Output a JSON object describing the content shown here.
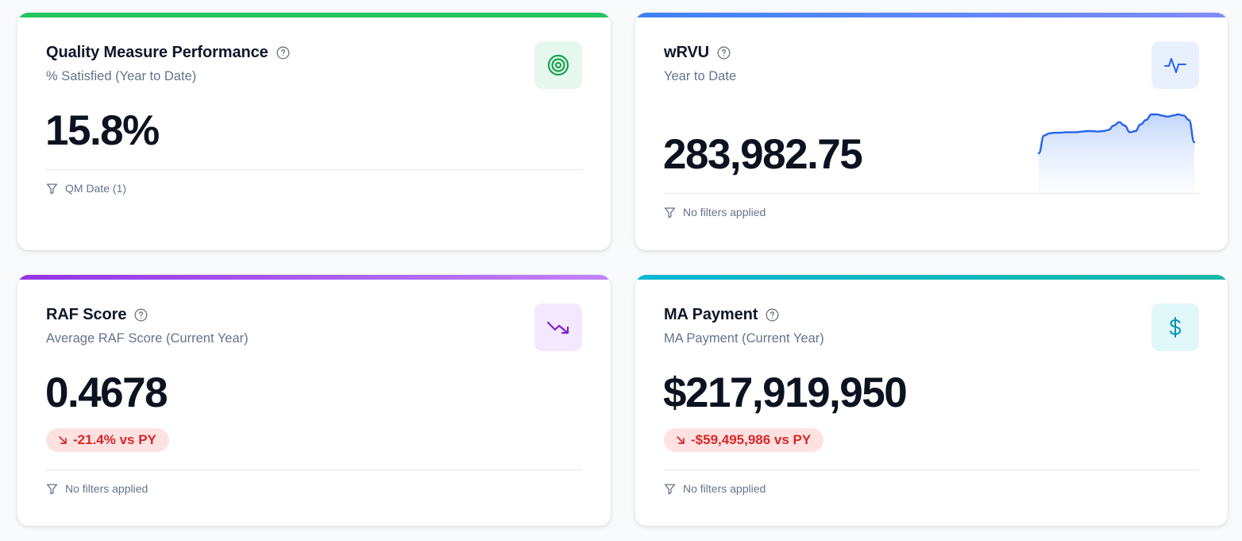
{
  "cards": [
    {
      "title": "Quality Measure Performance",
      "subtitle": "% Satisfied (Year to Date)",
      "value": "15.8%",
      "filter_text": "QM Date (1)",
      "icon": "target-icon",
      "accent_color": "#22c55e",
      "icon_bg": "#e6f7ee",
      "icon_color": "#16a34a"
    },
    {
      "title": "wRVU",
      "subtitle": "Year to Date",
      "value": "283,982.75",
      "filter_text": "No filters applied",
      "icon": "activity-icon",
      "accent_color": "#3b82f6",
      "icon_bg": "#e8f0fe",
      "icon_color": "#2563eb",
      "sparkline": [
        0.3,
        0.62,
        0.66,
        0.67,
        0.67,
        0.68,
        0.68,
        0.68,
        0.69,
        0.7,
        0.7,
        0.69,
        0.7,
        0.72,
        0.8,
        0.86,
        0.8,
        0.68,
        0.7,
        0.82,
        0.9,
        1.0,
        1.0,
        0.98,
        0.96,
        0.98,
        1.0,
        0.98,
        0.9,
        0.5
      ]
    },
    {
      "title": "RAF Score",
      "subtitle": "Average RAF Score (Current Year)",
      "value": "0.4678",
      "delta": "-21.4% vs PY",
      "filter_text": "No filters applied",
      "icon": "trending-down-icon",
      "accent_color": "#a855f7",
      "icon_bg": "#f3e8ff",
      "icon_color": "#7e22ce"
    },
    {
      "title": "MA Payment",
      "subtitle": "MA Payment (Current Year)",
      "value": "$217,919,950",
      "delta": "-$59,495,986 vs PY",
      "filter_text": "No filters applied",
      "icon": "dollar-icon",
      "accent_color": "#06b6d4",
      "icon_bg": "#e0f7fa",
      "icon_color": "#0891b2"
    }
  ]
}
